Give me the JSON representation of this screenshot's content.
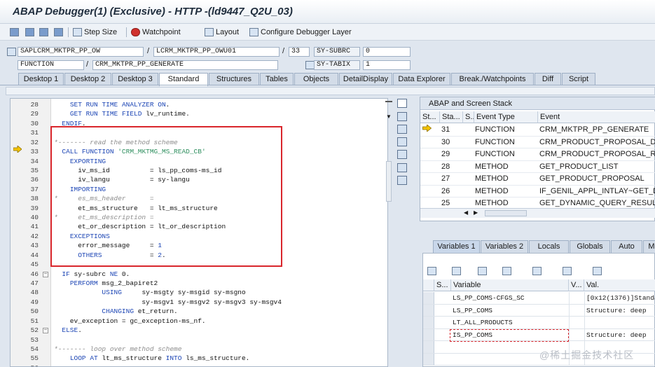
{
  "window": {
    "title": "ABAP Debugger(1)  (Exclusive) - HTTP -(ld9447_Q2U_03)"
  },
  "toolbar": {
    "step_size": "Step Size",
    "watchpoint": "Watchpoint",
    "layout": "Layout",
    "configure": "Configure Debugger Layer"
  },
  "context": {
    "program": "SAPLCRM_MKTPR_PP_OW",
    "include": "LCRM_MKTPR_PP_OWU01",
    "line": "33",
    "kind": "FUNCTION",
    "name": "CRM_MKTPR_PP_GENERATE",
    "subrc_label": "SY-SUBRC",
    "subrc_value": "0",
    "tabix_label": "SY-TABIX",
    "tabix_value": "1",
    "slash": "/"
  },
  "tabs": [
    "Desktop 1",
    "Desktop 2",
    "Desktop 3",
    "Standard",
    "Structures",
    "Tables",
    "Objects",
    "DetailDisplay",
    "Data Explorer",
    "Break./Watchpoints",
    "Diff",
    "Script"
  ],
  "active_tab": "Standard",
  "code_lines": [
    {
      "n": "28",
      "t": "    SET RUN TIME ANALYZER ON."
    },
    {
      "n": "29",
      "t": "    GET RUN TIME FIELD lv_runtime."
    },
    {
      "n": "30",
      "t": "  ENDIF."
    },
    {
      "n": "31",
      "t": ""
    },
    {
      "n": "32",
      "t": "*------- read the method scheme"
    },
    {
      "n": "33",
      "t": "  CALL FUNCTION 'CRM_MKTMG_MS_READ_CB'"
    },
    {
      "n": "34",
      "t": "    EXPORTING"
    },
    {
      "n": "35",
      "t": "      iv_ms_id          = ls_pp_coms-ms_id"
    },
    {
      "n": "36",
      "t": "      iv_langu          = sy-langu"
    },
    {
      "n": "37",
      "t": "    IMPORTING"
    },
    {
      "n": "38",
      "t": "*     es_ms_header      ="
    },
    {
      "n": "39",
      "t": "      et_ms_structure   = lt_ms_structure"
    },
    {
      "n": "40",
      "t": "*     et_ms_description ="
    },
    {
      "n": "41",
      "t": "      et_or_description = lt_or_description"
    },
    {
      "n": "42",
      "t": "    EXCEPTIONS"
    },
    {
      "n": "43",
      "t": "      error_message     = 1"
    },
    {
      "n": "44",
      "t": "      OTHERS            = 2."
    },
    {
      "n": "45",
      "t": ""
    },
    {
      "n": "46",
      "t": "  IF sy-subrc NE 0."
    },
    {
      "n": "47",
      "t": "    PERFORM msg_2_bapiret2"
    },
    {
      "n": "48",
      "t": "            USING     sy-msgty sy-msgid sy-msgno"
    },
    {
      "n": "49",
      "t": "                      sy-msgv1 sy-msgv2 sy-msgv3 sy-msgv4"
    },
    {
      "n": "50",
      "t": "            CHANGING et_return."
    },
    {
      "n": "51",
      "t": "    ev_exception = gc_exception-ms_nf."
    },
    {
      "n": "52",
      "t": "  ELSE."
    },
    {
      "n": "53",
      "t": ""
    },
    {
      "n": "54",
      "t": "*------- loop over method scheme"
    },
    {
      "n": "55",
      "t": "    LOOP AT lt_ms_structure INTO ls_ms_structure."
    },
    {
      "n": "56",
      "t": ""
    }
  ],
  "stack": {
    "title": "ABAP and Screen Stack",
    "columns": [
      "St...",
      "Sta...",
      "S...",
      "Event Type",
      "Event"
    ],
    "rows": [
      {
        "level": "31",
        "type": "FUNCTION",
        "event": "CRM_MKTPR_PP_GENERATE",
        "current": true
      },
      {
        "level": "30",
        "type": "FUNCTION",
        "event": "CRM_PRODUCT_PROPOSAL_DETERM"
      },
      {
        "level": "29",
        "type": "FUNCTION",
        "event": "CRM_PRODUCT_PROPOSAL_READ"
      },
      {
        "level": "28",
        "type": "METHOD",
        "event": "GET_PRODUCT_LIST"
      },
      {
        "level": "27",
        "type": "METHOD",
        "event": "GET_PRODUCT_PROPOSAL"
      },
      {
        "level": "26",
        "type": "METHOD",
        "event": "IF_GENIL_APPL_INTLAY~GET_DYNA"
      },
      {
        "level": "25",
        "type": "METHOD",
        "event": "GET_DYNAMIC_QUERY_RESULT"
      }
    ]
  },
  "var_tabs": [
    "Variables 1",
    "Variables 2",
    "Locals",
    "Globals",
    "Auto",
    "Me"
  ],
  "variables": {
    "columns": [
      "S...",
      "Variable",
      "V...",
      "Val."
    ],
    "rows": [
      {
        "name": "LS_PP_COMS-CFGS_SC",
        "value": "[0x12(1376)]Standa"
      },
      {
        "name": "LS_PP_COMS",
        "value": "Structure: deep"
      },
      {
        "name": "LT_ALL_PRODUCTS",
        "value": "",
        "flag": true
      },
      {
        "name": "IS_PP_COMS",
        "value": "Structure: deep"
      }
    ]
  },
  "watermark": "@稀土掘金技术社区",
  "colors": {
    "accent_red": "#d9262c",
    "keyword_blue": "#1d46b5",
    "string_green": "#2f8f5f"
  }
}
